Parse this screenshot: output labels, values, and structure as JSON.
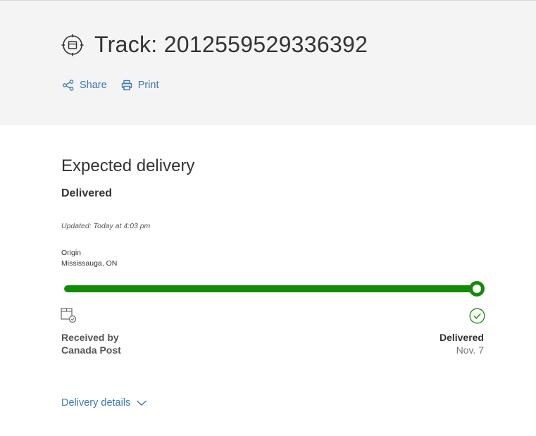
{
  "header": {
    "title_prefix": "Track: ",
    "tracking_number": "2012559529336392",
    "title_icon": "target-package-icon",
    "actions": {
      "share_label": "Share",
      "share_icon": "share-icon",
      "print_label": "Print",
      "print_icon": "printer-icon"
    }
  },
  "delivery": {
    "section_title": "Expected delivery",
    "status": "Delivered",
    "updated": "Updated: Today at 4:03 pm",
    "origin_label": "Origin",
    "origin_value": "Mississauga, ON",
    "progress_fraction": 1.0,
    "start": {
      "icon": "package-received-icon",
      "line1": "Received by",
      "line2": "Canada Post"
    },
    "end": {
      "icon": "check-circle-icon",
      "line1": "Delivered",
      "line2": "Nov. 7"
    }
  },
  "footer": {
    "details_label": "Delivery details",
    "details_icon": "chevron-down-icon"
  },
  "colors": {
    "link": "#3b78b9",
    "progress": "#138a08",
    "header_bg": "#f4f4f4"
  }
}
